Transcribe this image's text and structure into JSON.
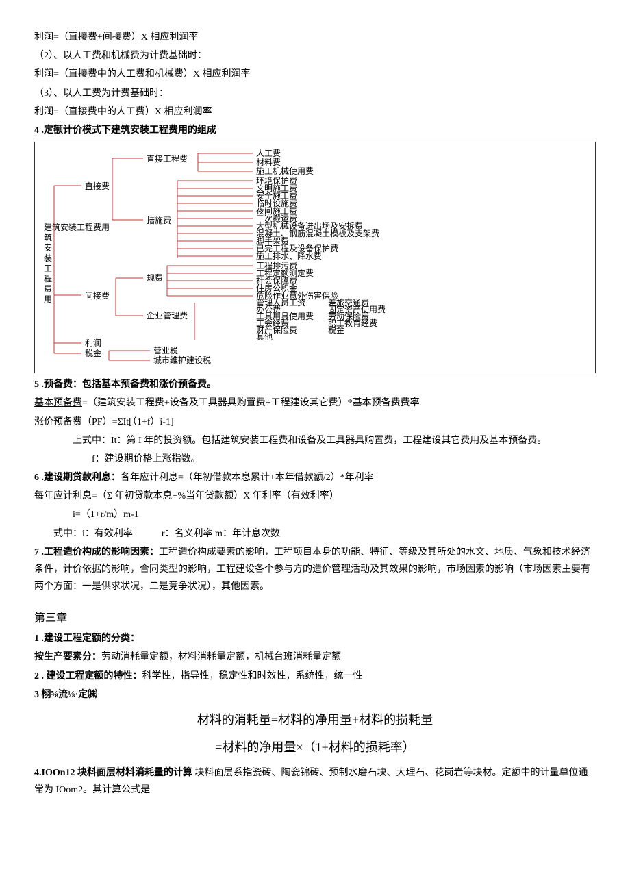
{
  "top": {
    "l1": "利润=（直接费+间接费）X 相应利润率",
    "l2": "（2）、以人工费和机械费为计费基础时：",
    "l3": "利润=（直接费中的人工费和机械费）X 相应利润率",
    "l4": "（3）、以人工费为计费基础时：",
    "l5": "利润=（直接费中的人工费）X 相应利润率"
  },
  "s4": {
    "title": "4  .定额计价模式下建筑安装工程费用的组成"
  },
  "diagram": {
    "root": "建筑安装工程费用",
    "b1": {
      "label": "直接费",
      "c1": {
        "label": "直接工程费",
        "items": [
          "人工费",
          "材料费",
          "施工机械使用费"
        ]
      },
      "c2": {
        "label": "措施费",
        "items": [
          "环境保护费",
          "文明施工费",
          "安全施工费",
          "临时设施费",
          "夜间施工费",
          "二次搬运费",
          "大型机械设备进出场及安拆费",
          "混凝土、钢筋混凝土模板及支架费",
          "脚手架费",
          "已完工程及设备保护费",
          "施工排水、降水费"
        ]
      }
    },
    "b2": {
      "label": "间接费",
      "c1": {
        "label": "规费",
        "items": [
          "工程排污费",
          "工程定额测定费",
          "社会保障费",
          "住房公积金",
          "危险作业意外伤害保险"
        ]
      },
      "c2": {
        "label": "企业管理费",
        "items": [
          "管理人员工资",
          "办公费",
          "差旅交通费",
          "固定资产使用费",
          "工具用具使用费",
          "劳动保险费",
          "工会经费",
          "职工教育经费",
          "财产保险费",
          "税金",
          "其他"
        ]
      }
    },
    "b3": {
      "label": "利润"
    },
    "b4": {
      "label": "税金",
      "items": [
        "营业税",
        "城市维护建设税"
      ]
    }
  },
  "s5": {
    "title": "5  .预备费：包括基本预备费和涨价预备费。",
    "l1a": "基本预备费",
    "l1b": "=（建筑安装工程费+设备及工具器具购置费+工程建设其它费）*基本预备费费率",
    "l2": "涨价预备费（PF）=ΣIt[（1+f）i-1]",
    "l3": "上式中：It：第 I 年的投资额。包括建筑安装工程费和设备及工具器具购置费，工程建设其它费用及基本预备费。",
    "l4": "f：建设期价格上涨指数。"
  },
  "s6": {
    "title": "6  .建设期贷款利息：",
    "t1": "各年应计利息=（年初借款本息累计+本年借款额/2）*年利率",
    "l2": "每年应计利息=（Σ 年初贷款本息+%当年贷款额）X 年利率（有效利率）",
    "l3": "i=（1+r/m）m-1",
    "l4": "式中：i：有效利率　　　r：名义利率  m：年计息次数"
  },
  "s7": {
    "title": "7  .工程造价构成的影响因素：",
    "t1": "工程造价构成要素的影响，工程项目本身的功能、特征、等级及其所处的水文、地质、气象和技术经济条件，计价依据的影响，合同类型的影响，工程建设各个参与方的造价管理活动及其效果的影响，市场因素的影响（市场因素主要有两个方面：一是供求状况，二是竞争状况），其他因素。"
  },
  "ch3": {
    "title": "第三章",
    "s1": {
      "title": "1  .建设工程定额的分类：",
      "l1a": "按生产要素分：",
      "l1b": "劳动消耗量定额，材料消耗量定额，机械台班消耗量定额"
    },
    "s2": {
      "title": "2  . 建设工程定额的特性：",
      "t1": "科学性，指导性，稳定性和时效性，系统性，统一性"
    },
    "s3": {
      "title": "3 栩⅝流⅛·定㈱",
      "f1": "材料的消耗量=材料的净用量+材料的损耗量",
      "f2": "=材料的净用量×（1+材料的损耗率）"
    },
    "s4": {
      "title": "4.IOOn12 块料面层材料消耗量的计算",
      "l1": " 块料面层系指瓷砖、陶瓷锦砖、预制水磨石块、大理石、花岗岩等块材。定额中的计量单位通常为 IOom2。其计算公式是"
    }
  }
}
